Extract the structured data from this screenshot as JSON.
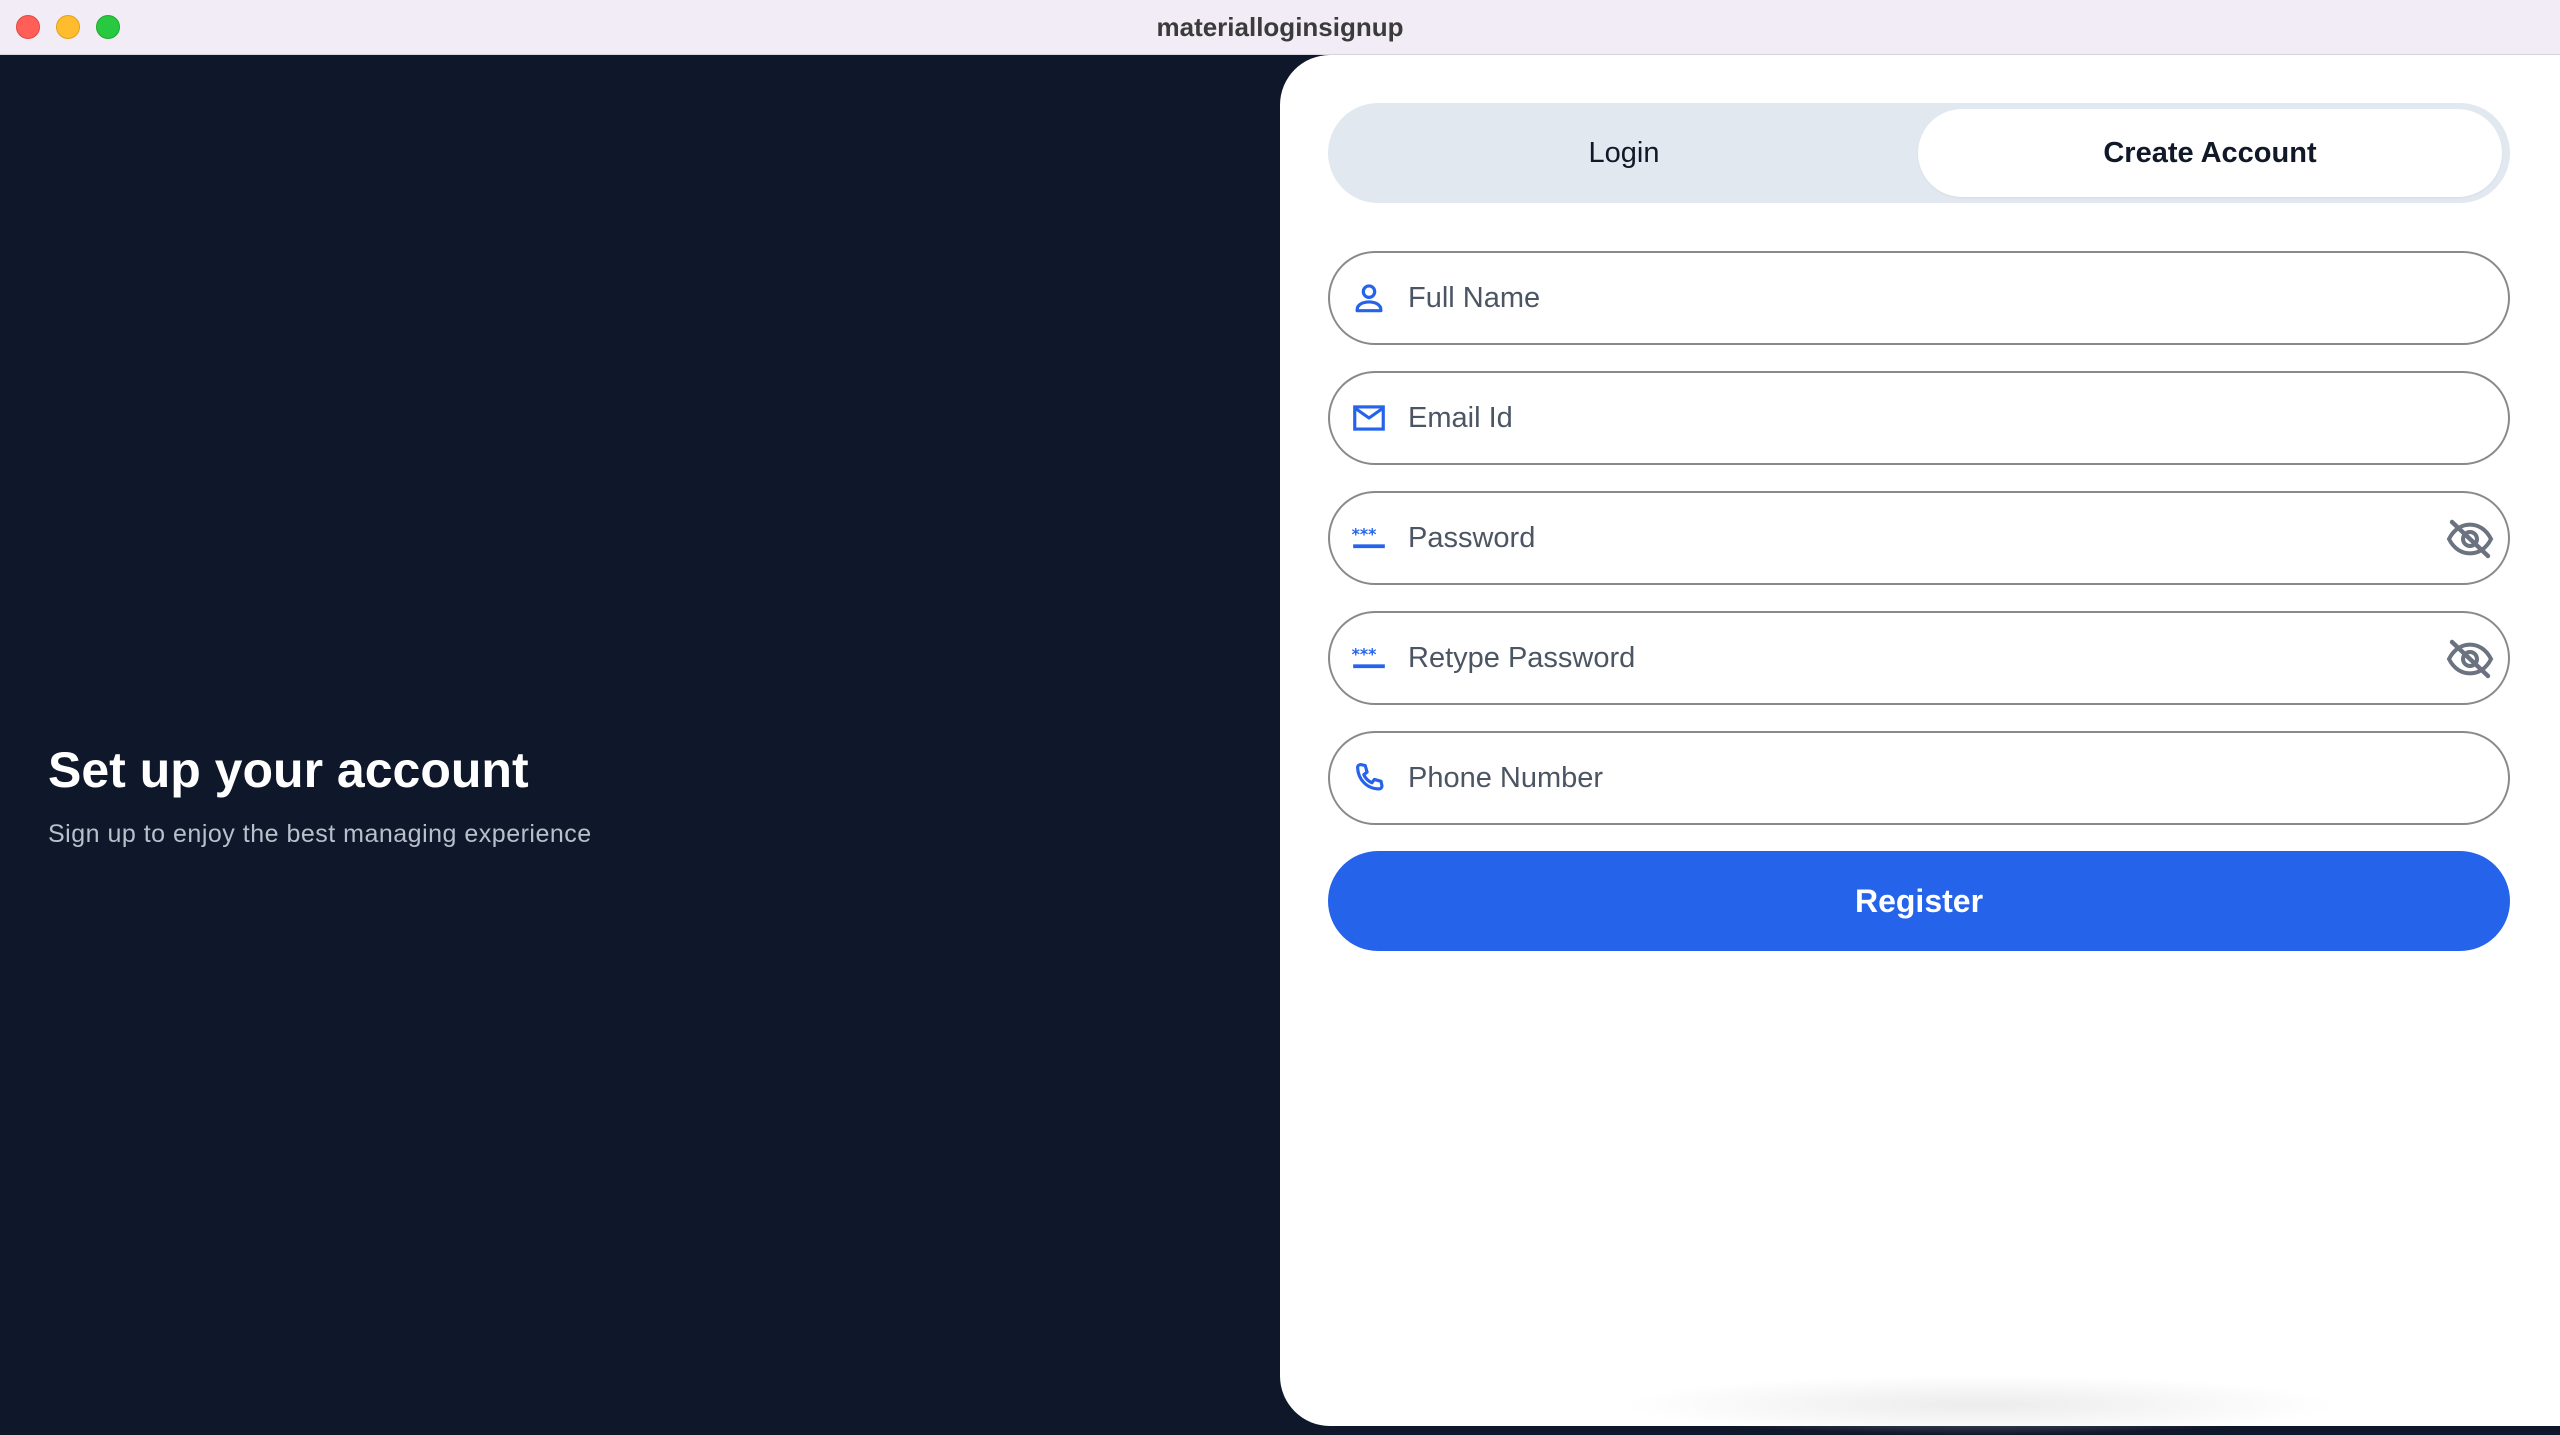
{
  "window": {
    "title": "materialloginsignup"
  },
  "hero": {
    "title": "Set up your account",
    "subtitle": "Sign up to enjoy the best managing experience"
  },
  "tabs": {
    "login_label": "Login",
    "create_label": "Create Account",
    "active": "Create Account"
  },
  "form": {
    "full_name": {
      "placeholder": "Full Name",
      "value": "",
      "icon": "person-icon"
    },
    "email": {
      "placeholder": "Email Id",
      "value": "",
      "icon": "mail-icon"
    },
    "password": {
      "placeholder": "Password",
      "value": "",
      "icon": "password-dots-icon",
      "toggle_icon": "eye-off-icon"
    },
    "retype_password": {
      "placeholder": "Retype Password",
      "value": "",
      "icon": "password-dots-icon",
      "toggle_icon": "eye-off-icon"
    },
    "phone": {
      "placeholder": "Phone Number",
      "value": "",
      "icon": "phone-icon"
    },
    "register_label": "Register"
  },
  "colors": {
    "accent": "#2563eb",
    "left_panel": "#0f172a",
    "tab_track": "#e2e8f0",
    "icon": "#2563eb",
    "toggle_icon": "#6b7280"
  }
}
